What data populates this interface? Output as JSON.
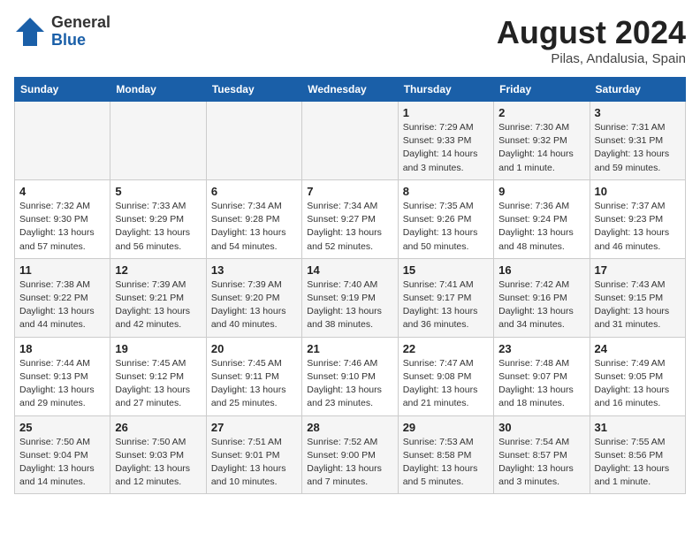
{
  "header": {
    "logo_general": "General",
    "logo_blue": "Blue",
    "title": "August 2024",
    "subtitle": "Pilas, Andalusia, Spain"
  },
  "calendar": {
    "weekdays": [
      "Sunday",
      "Monday",
      "Tuesday",
      "Wednesday",
      "Thursday",
      "Friday",
      "Saturday"
    ],
    "weeks": [
      [
        {
          "day": "",
          "info": ""
        },
        {
          "day": "",
          "info": ""
        },
        {
          "day": "",
          "info": ""
        },
        {
          "day": "",
          "info": ""
        },
        {
          "day": "1",
          "info": "Sunrise: 7:29 AM\nSunset: 9:33 PM\nDaylight: 14 hours\nand 3 minutes."
        },
        {
          "day": "2",
          "info": "Sunrise: 7:30 AM\nSunset: 9:32 PM\nDaylight: 14 hours\nand 1 minute."
        },
        {
          "day": "3",
          "info": "Sunrise: 7:31 AM\nSunset: 9:31 PM\nDaylight: 13 hours\nand 59 minutes."
        }
      ],
      [
        {
          "day": "4",
          "info": "Sunrise: 7:32 AM\nSunset: 9:30 PM\nDaylight: 13 hours\nand 57 minutes."
        },
        {
          "day": "5",
          "info": "Sunrise: 7:33 AM\nSunset: 9:29 PM\nDaylight: 13 hours\nand 56 minutes."
        },
        {
          "day": "6",
          "info": "Sunrise: 7:34 AM\nSunset: 9:28 PM\nDaylight: 13 hours\nand 54 minutes."
        },
        {
          "day": "7",
          "info": "Sunrise: 7:34 AM\nSunset: 9:27 PM\nDaylight: 13 hours\nand 52 minutes."
        },
        {
          "day": "8",
          "info": "Sunrise: 7:35 AM\nSunset: 9:26 PM\nDaylight: 13 hours\nand 50 minutes."
        },
        {
          "day": "9",
          "info": "Sunrise: 7:36 AM\nSunset: 9:24 PM\nDaylight: 13 hours\nand 48 minutes."
        },
        {
          "day": "10",
          "info": "Sunrise: 7:37 AM\nSunset: 9:23 PM\nDaylight: 13 hours\nand 46 minutes."
        }
      ],
      [
        {
          "day": "11",
          "info": "Sunrise: 7:38 AM\nSunset: 9:22 PM\nDaylight: 13 hours\nand 44 minutes."
        },
        {
          "day": "12",
          "info": "Sunrise: 7:39 AM\nSunset: 9:21 PM\nDaylight: 13 hours\nand 42 minutes."
        },
        {
          "day": "13",
          "info": "Sunrise: 7:39 AM\nSunset: 9:20 PM\nDaylight: 13 hours\nand 40 minutes."
        },
        {
          "day": "14",
          "info": "Sunrise: 7:40 AM\nSunset: 9:19 PM\nDaylight: 13 hours\nand 38 minutes."
        },
        {
          "day": "15",
          "info": "Sunrise: 7:41 AM\nSunset: 9:17 PM\nDaylight: 13 hours\nand 36 minutes."
        },
        {
          "day": "16",
          "info": "Sunrise: 7:42 AM\nSunset: 9:16 PM\nDaylight: 13 hours\nand 34 minutes."
        },
        {
          "day": "17",
          "info": "Sunrise: 7:43 AM\nSunset: 9:15 PM\nDaylight: 13 hours\nand 31 minutes."
        }
      ],
      [
        {
          "day": "18",
          "info": "Sunrise: 7:44 AM\nSunset: 9:13 PM\nDaylight: 13 hours\nand 29 minutes."
        },
        {
          "day": "19",
          "info": "Sunrise: 7:45 AM\nSunset: 9:12 PM\nDaylight: 13 hours\nand 27 minutes."
        },
        {
          "day": "20",
          "info": "Sunrise: 7:45 AM\nSunset: 9:11 PM\nDaylight: 13 hours\nand 25 minutes."
        },
        {
          "day": "21",
          "info": "Sunrise: 7:46 AM\nSunset: 9:10 PM\nDaylight: 13 hours\nand 23 minutes."
        },
        {
          "day": "22",
          "info": "Sunrise: 7:47 AM\nSunset: 9:08 PM\nDaylight: 13 hours\nand 21 minutes."
        },
        {
          "day": "23",
          "info": "Sunrise: 7:48 AM\nSunset: 9:07 PM\nDaylight: 13 hours\nand 18 minutes."
        },
        {
          "day": "24",
          "info": "Sunrise: 7:49 AM\nSunset: 9:05 PM\nDaylight: 13 hours\nand 16 minutes."
        }
      ],
      [
        {
          "day": "25",
          "info": "Sunrise: 7:50 AM\nSunset: 9:04 PM\nDaylight: 13 hours\nand 14 minutes."
        },
        {
          "day": "26",
          "info": "Sunrise: 7:50 AM\nSunset: 9:03 PM\nDaylight: 13 hours\nand 12 minutes."
        },
        {
          "day": "27",
          "info": "Sunrise: 7:51 AM\nSunset: 9:01 PM\nDaylight: 13 hours\nand 10 minutes."
        },
        {
          "day": "28",
          "info": "Sunrise: 7:52 AM\nSunset: 9:00 PM\nDaylight: 13 hours\nand 7 minutes."
        },
        {
          "day": "29",
          "info": "Sunrise: 7:53 AM\nSunset: 8:58 PM\nDaylight: 13 hours\nand 5 minutes."
        },
        {
          "day": "30",
          "info": "Sunrise: 7:54 AM\nSunset: 8:57 PM\nDaylight: 13 hours\nand 3 minutes."
        },
        {
          "day": "31",
          "info": "Sunrise: 7:55 AM\nSunset: 8:56 PM\nDaylight: 13 hours\nand 1 minute."
        }
      ]
    ]
  }
}
